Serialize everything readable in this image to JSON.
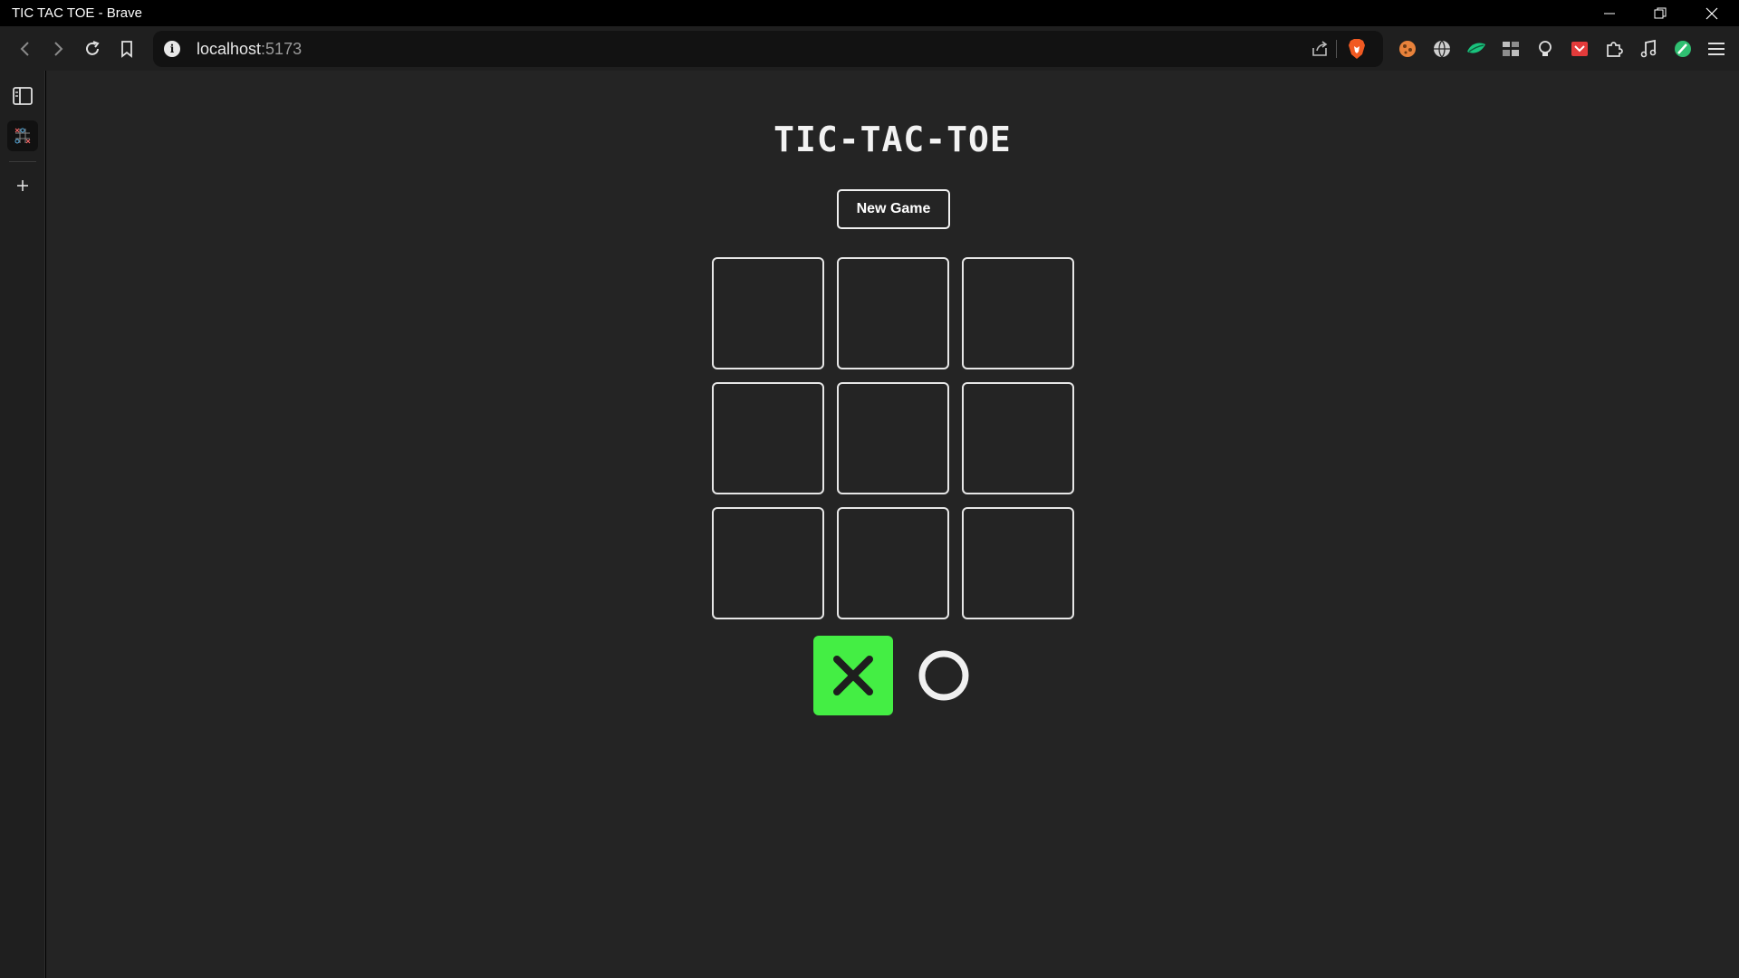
{
  "window": {
    "title": "TIC TAC TOE - Brave"
  },
  "toolbar": {
    "url_host": "localhost",
    "url_port": ":5173"
  },
  "game": {
    "title": "TIC-TAC-TOE",
    "new_game_label": "New Game",
    "board": [
      "",
      "",
      "",
      "",
      "",
      "",
      "",
      "",
      ""
    ],
    "players": [
      {
        "symbol": "X",
        "icon": "x-icon",
        "active": true
      },
      {
        "symbol": "O",
        "icon": "o-icon",
        "active": false
      }
    ],
    "colors": {
      "active_player_bg": "#44ee44",
      "page_bg": "#242424",
      "cell_border": "#e6e6e6"
    }
  }
}
